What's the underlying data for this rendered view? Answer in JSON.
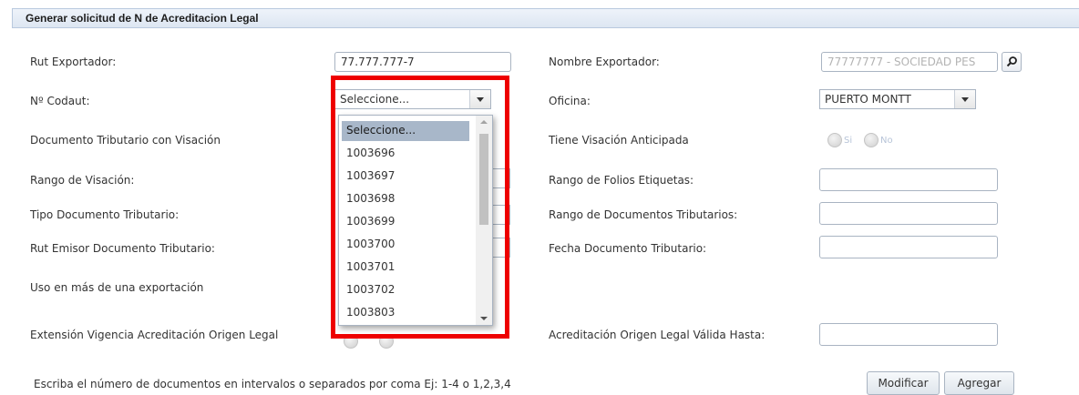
{
  "panel": {
    "title": "Generar solicitud de N de Acreditacion Legal"
  },
  "left_labels": {
    "rut_exportador": "Rut Exportador:",
    "codaut": "Nº Codaut:",
    "doc_tributario_visacion": "Documento Tributario con Visación",
    "rango_visacion": "Rango de Visación:",
    "tipo_documento": "Tipo Documento Tributario:",
    "rut_emisor": "Rut Emisor Documento Tributario:",
    "uso_mas_exportacion": "Uso en más de una exportación",
    "extension_vigencia": "Extensión Vigencia Acreditación Origen Legal"
  },
  "right_labels": {
    "nombre_exportador": "Nombre Exportador:",
    "oficina": "Oficina:",
    "visacion_anticipada": "Tiene Visación Anticipada",
    "rango_folios": "Rango de Folios Etiquetas:",
    "rango_documentos": "Rango de Documentos Tributarios:",
    "fecha_documento": "Fecha Documento Tributario:",
    "acreditacion_valida": "Acreditación Origen Legal Válida Hasta:"
  },
  "fields": {
    "rut_exportador_value": "77.777.777-7",
    "nombre_exportador_value": "77777777 - SOCIEDAD PES",
    "codaut_selected": "Seleccione...",
    "oficina_selected": "PUERTO MONTT"
  },
  "radio": {
    "si": "Si",
    "no": "No"
  },
  "codaut_options": [
    "Seleccione...",
    "1003696",
    "1003697",
    "1003698",
    "1003699",
    "1003700",
    "1003701",
    "1003702",
    "1003803"
  ],
  "footer": {
    "hint": "Escriba el número de documentos en intervalos o separados por coma Ej: 1-4 o 1,2,3,4",
    "modificar": "Modificar",
    "agregar": "Agregar"
  },
  "colors": {
    "highlight": "#ee0000",
    "selected_option": "#a8b7c9"
  },
  "icons": {
    "search": "search-icon",
    "dropdown": "chevron-down-icon"
  }
}
